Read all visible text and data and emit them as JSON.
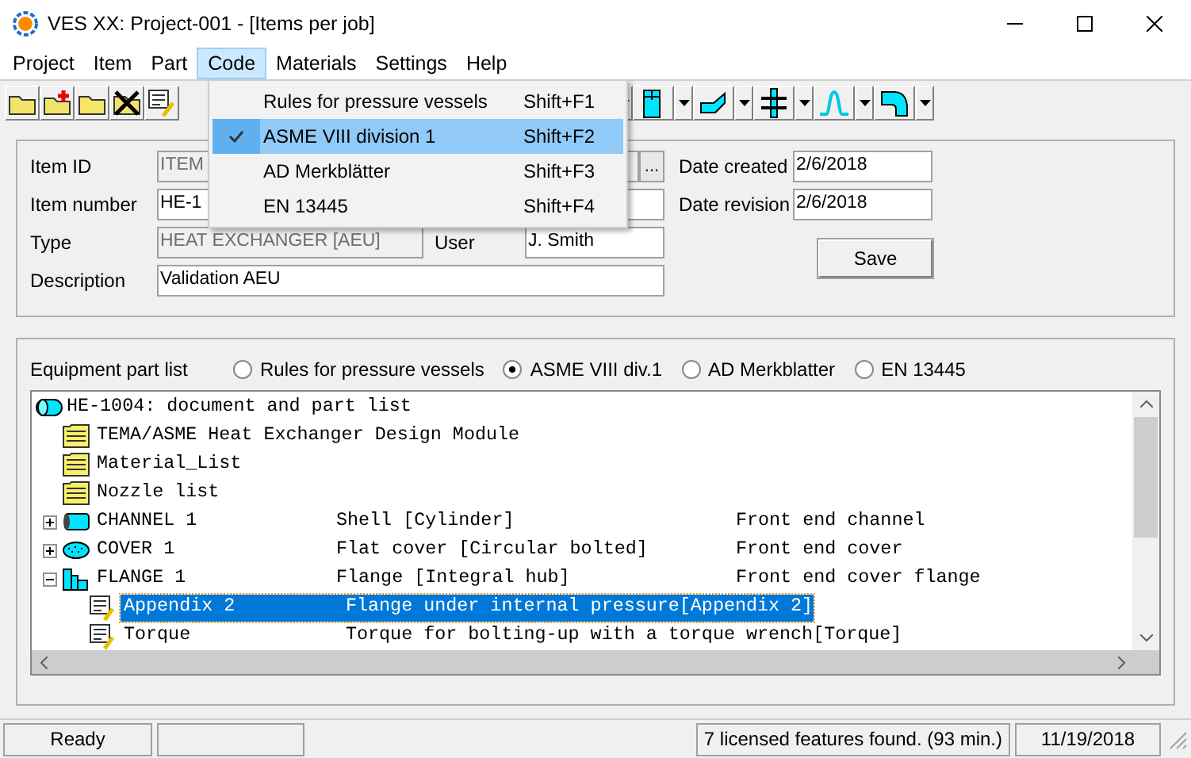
{
  "window": {
    "title": "VES XX: Project-001 - [Items per job]"
  },
  "menu_bar": [
    {
      "label": "Project",
      "selected": false
    },
    {
      "label": "Item",
      "selected": false
    },
    {
      "label": "Part",
      "selected": false
    },
    {
      "label": "Code",
      "selected": true
    },
    {
      "label": "Materials",
      "selected": false
    },
    {
      "label": "Settings",
      "selected": false
    },
    {
      "label": "Help",
      "selected": false
    }
  ],
  "code_menu": [
    {
      "label": "Rules for pressure vessels",
      "shortcut": "Shift+F1",
      "checked": false,
      "selected": false
    },
    {
      "label": "ASME VIII division 1",
      "shortcut": "Shift+F2",
      "checked": true,
      "selected": true
    },
    {
      "label": "AD Merkblätter",
      "shortcut": "Shift+F3",
      "checked": false,
      "selected": false
    },
    {
      "label": "EN 13445",
      "shortcut": "Shift+F4",
      "checked": false,
      "selected": false
    }
  ],
  "form": {
    "item_id": {
      "label": "Item ID",
      "value": "ITEM",
      "disabled": true,
      "browse": "..."
    },
    "item_number": {
      "label": "Item number",
      "value": "HE-1"
    },
    "type": {
      "label": "Type",
      "value": "HEAT EXCHANGER [AEU]",
      "disabled": true
    },
    "user": {
      "label": "User",
      "value": "J. Smith"
    },
    "description": {
      "label": "Description",
      "value": "Validation AEU"
    },
    "date_created": {
      "label": "Date created",
      "value": "2/6/2018"
    },
    "date_revision": {
      "label": "Date revision",
      "value": "2/6/2018"
    },
    "save_button": "Save"
  },
  "part_list": {
    "label": "Equipment part list",
    "radios": [
      {
        "label": "Rules for pressure vessels",
        "selected": false
      },
      {
        "label": "ASME VIII div.1",
        "selected": true
      },
      {
        "label": "AD Merkblatter",
        "selected": false
      },
      {
        "label": "EN 13445",
        "selected": false
      }
    ],
    "tree": {
      "label": "HE-1004: document and part list",
      "children": [
        {
          "kind": "document",
          "name": "TEMA/ASME Heat Exchanger Design Module",
          "selected": false
        },
        {
          "kind": "document",
          "name": "Material_List",
          "selected": false
        },
        {
          "kind": "document",
          "name": "Nozzle list",
          "selected": false
        },
        {
          "kind": "channel",
          "name": "CHANNEL 1",
          "description": "Shell [Cylinder]",
          "location": "Front end channel",
          "expanded": false,
          "selected": false
        },
        {
          "kind": "cover",
          "name": "COVER 1",
          "description": "Flat cover [Circular bolted]",
          "location": "Front end cover",
          "expanded": false,
          "selected": false
        },
        {
          "kind": "flange",
          "name": "FLANGE 1",
          "description": "Flange [Integral hub]",
          "location": "Front end cover flange",
          "expanded": true,
          "selected": false,
          "children": [
            {
              "kind": "calculation",
              "name": "Appendix 2",
              "description": "Flange under internal pressure[Appendix 2]",
              "selected": true
            },
            {
              "kind": "calculation",
              "name": "Torque",
              "description": "Torque for bolting-up with a torque wrench[Torque]",
              "selected": false
            }
          ]
        }
      ]
    }
  },
  "status_bar": [
    {
      "kind": "text",
      "text": "Ready"
    },
    {
      "kind": "empty"
    },
    {
      "kind": "spacer"
    },
    {
      "kind": "text",
      "text": "7 licensed features found. (93 min.)"
    },
    {
      "kind": "text",
      "text": "11/19/2018"
    }
  ]
}
